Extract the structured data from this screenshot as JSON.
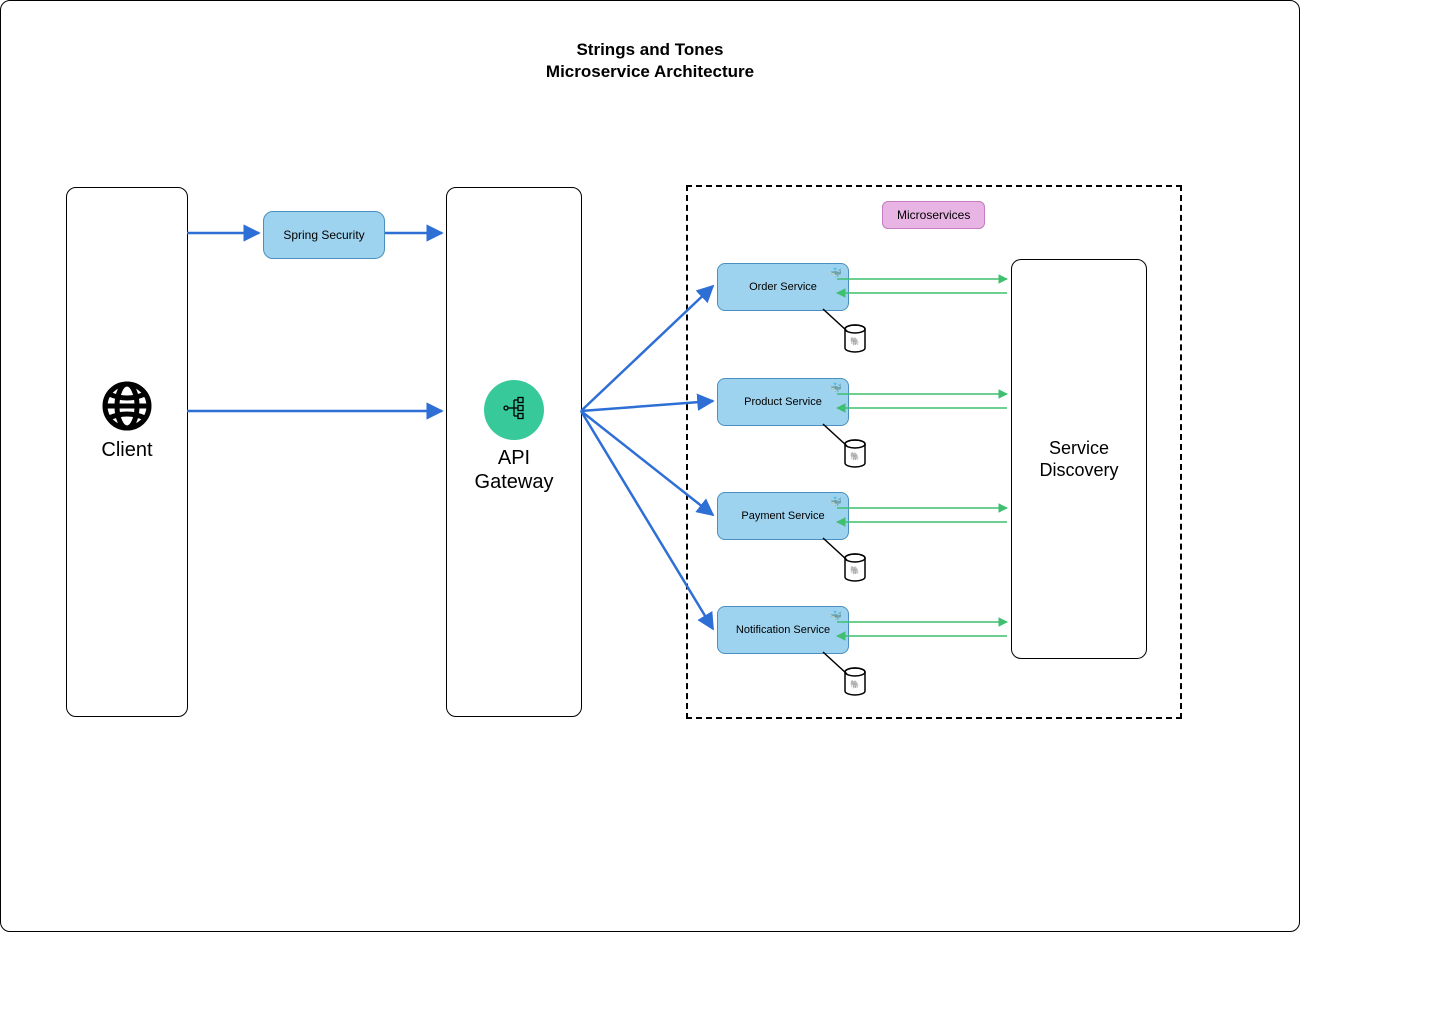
{
  "title": {
    "line1": "Strings and Tones",
    "line2": "Microservice Architecture"
  },
  "client": {
    "label": "Client"
  },
  "spring_security": {
    "label": "Spring Security"
  },
  "api_gateway": {
    "label_line1": "API",
    "label_line2": "Gateway"
  },
  "microservices_region": {
    "badge": "Microservices"
  },
  "services": [
    {
      "name": "Order Service"
    },
    {
      "name": "Product Service"
    },
    {
      "name": "Payment Service"
    },
    {
      "name": "Notification Service"
    }
  ],
  "service_discovery": {
    "label_line1": "Service",
    "label_line2": "Discovery"
  },
  "colors": {
    "arrow_blue": "#2e6fd6",
    "arrow_green": "#3fbf6f",
    "service_fill": "#9ed3ef",
    "badge_fill": "#e8b4e4",
    "gateway_fill": "#38c99b"
  }
}
